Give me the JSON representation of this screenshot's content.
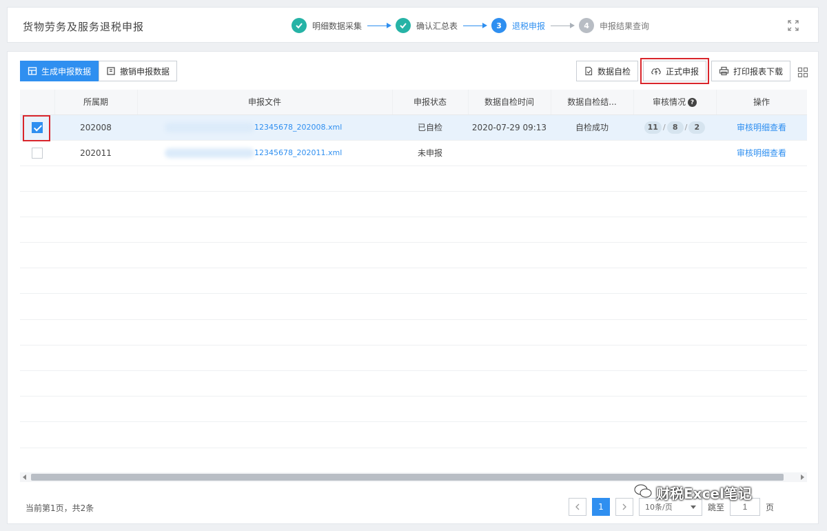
{
  "header": {
    "title": "货物劳务及服务退税申报",
    "steps": [
      {
        "number": "1",
        "label": "明细数据采集",
        "status": "done"
      },
      {
        "number": "2",
        "label": "确认汇总表",
        "status": "done"
      },
      {
        "number": "3",
        "label": "退税申报",
        "status": "current"
      },
      {
        "number": "4",
        "label": "申报结果查询",
        "status": "todo"
      }
    ],
    "fullscreen_icon": "expand-icon"
  },
  "toolbar": {
    "generate_label": "生成申报数据",
    "withdraw_label": "撤销申报数据",
    "self_check_label": "数据自检",
    "formal_submit_label": "正式申报",
    "print_download_label": "打印报表下载",
    "grid_icon": "column-settings-icon"
  },
  "table": {
    "columns": [
      "",
      "所属期",
      "申报文件",
      "申报状态",
      "数据自检时间",
      "数据自检结...",
      "审核情况",
      "操作"
    ],
    "help_icon": "?",
    "rows": [
      {
        "checked": true,
        "period": "202008",
        "file": "12345678_202008.xml",
        "status": "已自检",
        "check_time": "2020-07-29 09:13",
        "check_result": "自检成功",
        "audit": [
          "11",
          "8",
          "2"
        ],
        "action": "审核明细查看"
      },
      {
        "checked": false,
        "period": "202011",
        "file": "12345678_202011.xml",
        "status": "未申报",
        "check_time": "",
        "check_result": "",
        "audit": [],
        "action": "审核明细查看"
      }
    ]
  },
  "footer": {
    "info": "当前第1页，共2条",
    "current_page": "1",
    "page_size": "10条/页",
    "goto_label": "跳至",
    "goto_value": "1",
    "page_suffix": "页"
  },
  "watermark": {
    "text": "财税Excel笔记"
  },
  "colors": {
    "primary": "#2f8ff0",
    "done": "#26b3a6",
    "highlight": "#d9252b"
  }
}
